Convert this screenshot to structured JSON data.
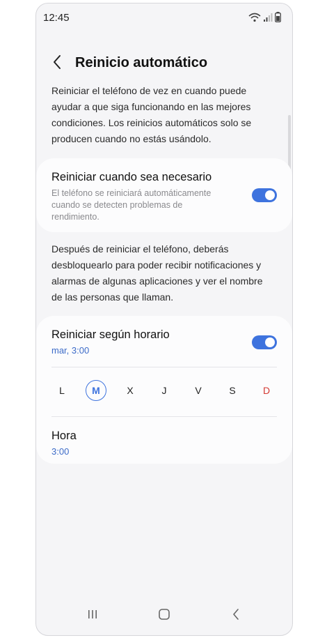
{
  "status_bar": {
    "time": "12:45"
  },
  "header": {
    "title": "Reinicio automático"
  },
  "intro": "Reiniciar el teléfono de vez en cuando puede ayudar a que siga funcionando en las mejores condiciones. Los reinicios automáticos solo se producen cuando no estás usándolo.",
  "restart_when_needed": {
    "title": "Reiniciar cuando sea necesario",
    "subtitle": "El teléfono se reiniciará automáticamente cuando se detecten problemas de rendimiento.",
    "enabled": true
  },
  "unlock_note": "Después de reiniciar el teléfono, deberás desbloquearlo para poder recibir notificaciones y alarmas de algunas aplicaciones y ver el nombre de las personas que llaman.",
  "scheduled_restart": {
    "title": "Reiniciar según horario",
    "value": "mar, 3:00",
    "enabled": true,
    "days": [
      "L",
      "M",
      "X",
      "J",
      "V",
      "S",
      "D"
    ],
    "selected_day": "M"
  },
  "time_setting": {
    "title": "Hora",
    "value": "3:00"
  },
  "colors": {
    "accent": "#3e73de",
    "link": "#3c6bc8",
    "sunday": "#d43a34",
    "background": "#f5f5f7"
  },
  "icons": {
    "back": "chevron-left-icon",
    "recent": "recent-apps-icon",
    "home": "home-icon",
    "nav_back": "nav-back-icon"
  }
}
